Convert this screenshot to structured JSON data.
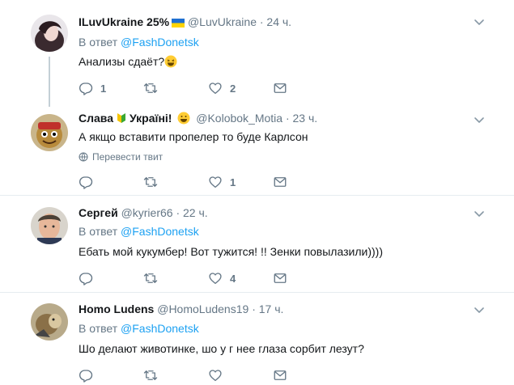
{
  "tweets": [
    {
      "name": "ILuvUkraine 25%",
      "handle": "@LuvUkraine",
      "time": "· 24 ч.",
      "reply_prefix": "В ответ",
      "reply_to": "@FashDonetsk",
      "text": "Анализы сдаёт?",
      "reply_count": "1",
      "retweet_count": "",
      "like_count": "2"
    },
    {
      "name": "Слава",
      "name2": "Україні!",
      "handle": "@Kolobok_Motia",
      "time": "· 23 ч.",
      "text": "А якщо вставити пропелер то буде Карлсон",
      "translate_label": "Перевести твит",
      "reply_count": "",
      "retweet_count": "",
      "like_count": "1"
    },
    {
      "name": "Сергей",
      "handle": "@kyrier66",
      "time": "· 22 ч.",
      "reply_prefix": "В ответ",
      "reply_to": "@FashDonetsk",
      "text": "Ебать мой кукумбер! Вот тужится! !! Зенки повылазили))))",
      "reply_count": "",
      "retweet_count": "",
      "like_count": "4"
    },
    {
      "name": "Homo Ludens",
      "handle": "@HomoLudens19",
      "time": "· 17 ч.",
      "reply_prefix": "В ответ",
      "reply_to": "@FashDonetsk",
      "text": "Шо делают  животинке, шо у г нее глаза сорбит лезут?",
      "reply_count": "",
      "retweet_count": "",
      "like_count": ""
    }
  ],
  "colors": {
    "accent": "#1da1f2",
    "muted": "#657786",
    "divider": "#e6ecf0"
  }
}
